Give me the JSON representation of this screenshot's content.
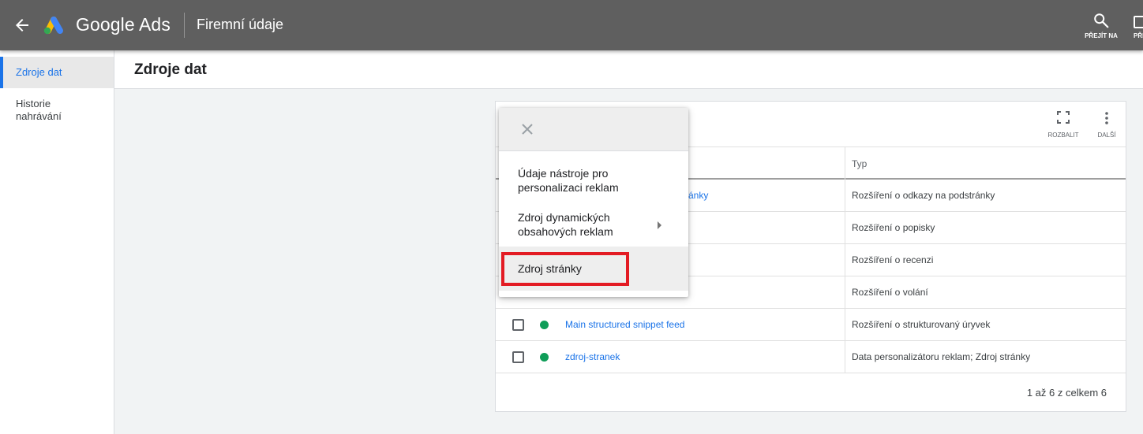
{
  "topbar": {
    "brand": "Google Ads",
    "page_title": "Firemní údaje",
    "goto_label": "PŘEJÍT NA",
    "reports_label": "PŘE"
  },
  "sidebar": {
    "items": [
      {
        "label": "Zdroje dat",
        "active": true
      },
      {
        "label": "Historie nahrávání",
        "active": false
      }
    ]
  },
  "header": {
    "title": "Zdroje dat"
  },
  "toolbar": {
    "expand_label": "ROZBALIT",
    "more_label": "DALŠÍ"
  },
  "table": {
    "columns": [
      "",
      "",
      "",
      "Typ"
    ],
    "rows": [
      {
        "name": "ránky",
        "type": "Rozšíření o odkazy na podstránky"
      },
      {
        "name": "",
        "type": "Rozšíření o popisky"
      },
      {
        "name": "",
        "type": "Rozšíření o recenzi"
      },
      {
        "name": "",
        "type": "Rozšíření o volání"
      },
      {
        "name": "Main structured snippet feed",
        "type": "Rozšíření o strukturovaný úryvek"
      },
      {
        "name": "zdroj-stranek",
        "type": "Data personalizátoru reklam; Zdroj stránky"
      }
    ],
    "pagination": "1 až 6 z celkem 6"
  },
  "menu": {
    "items": [
      {
        "label_lines": [
          "Údaje nástroje pro",
          "personalizaci reklam"
        ]
      },
      {
        "label_lines": [
          "Zdroj dynamických",
          "obsahových reklam"
        ],
        "has_submenu": true
      },
      {
        "label_lines": [
          "Zdroj stránky"
        ],
        "highlighted": true
      }
    ]
  },
  "colors": {
    "topbar": "#5f5f5f",
    "accent": "#1a73e8",
    "status_green": "#0f9d58",
    "highlight_box": "#e31b23"
  }
}
